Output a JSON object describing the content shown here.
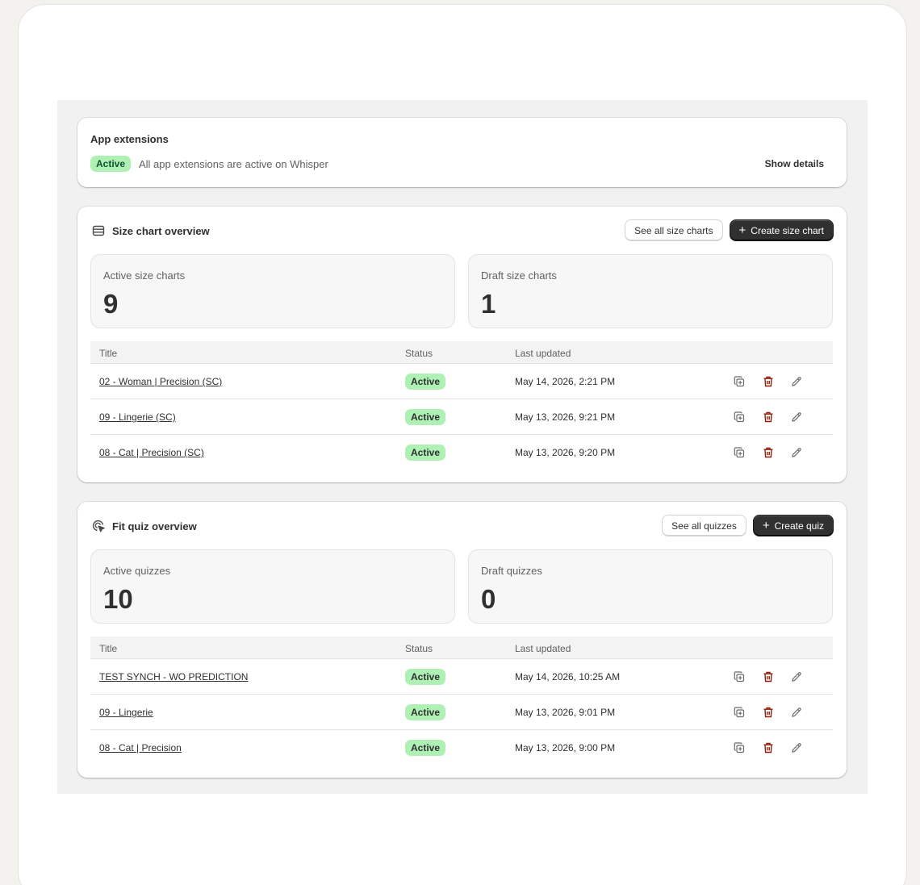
{
  "extensions": {
    "title": "App extensions",
    "badge": "Active",
    "description": "All app extensions are active on Whisper",
    "show_details": "Show details"
  },
  "size_chart": {
    "title": "Size chart overview",
    "see_all": "See all size charts",
    "create": "Create size chart",
    "active_label": "Active size charts",
    "active_count": "9",
    "draft_label": "Draft size charts",
    "draft_count": "1",
    "columns": {
      "title": "Title",
      "status": "Status",
      "updated": "Last updated"
    },
    "rows": [
      {
        "title": "02 - Woman | Precision (SC)",
        "status": "Active",
        "updated": "May 14, 2026, 2:21 PM"
      },
      {
        "title": "09 - Lingerie (SC)",
        "status": "Active",
        "updated": "May 13, 2026, 9:21 PM"
      },
      {
        "title": "08 - Cat | Precision (SC)",
        "status": "Active",
        "updated": "May 13, 2026, 9:20 PM"
      }
    ]
  },
  "fit_quiz": {
    "title": "Fit quiz overview",
    "see_all": "See all quizzes",
    "create": "Create quiz",
    "active_label": "Active quizzes",
    "active_count": "10",
    "draft_label": "Draft quizzes",
    "draft_count": "0",
    "columns": {
      "title": "Title",
      "status": "Status",
      "updated": "Last updated"
    },
    "rows": [
      {
        "title": "TEST SYNCH - WO PREDICTION",
        "status": "Active",
        "updated": "May 14, 2026, 10:25 AM"
      },
      {
        "title": "09 - Lingerie",
        "status": "Active",
        "updated": "May 13, 2026, 9:01 PM"
      },
      {
        "title": "08 - Cat | Precision",
        "status": "Active",
        "updated": "May 13, 2026, 9:00 PM"
      }
    ]
  },
  "icons": {
    "size_chart_header": "table-list-icon",
    "fit_quiz_header": "cursor-target-icon",
    "row_actions": [
      "duplicate-icon",
      "delete-icon",
      "edit-icon"
    ],
    "plus": "plus-icon"
  },
  "colors": {
    "badge_bg": "#aff0b5",
    "badge_text": "#0c5132",
    "primary_button": "#303030",
    "delete_icon": "#8e1f0b"
  }
}
